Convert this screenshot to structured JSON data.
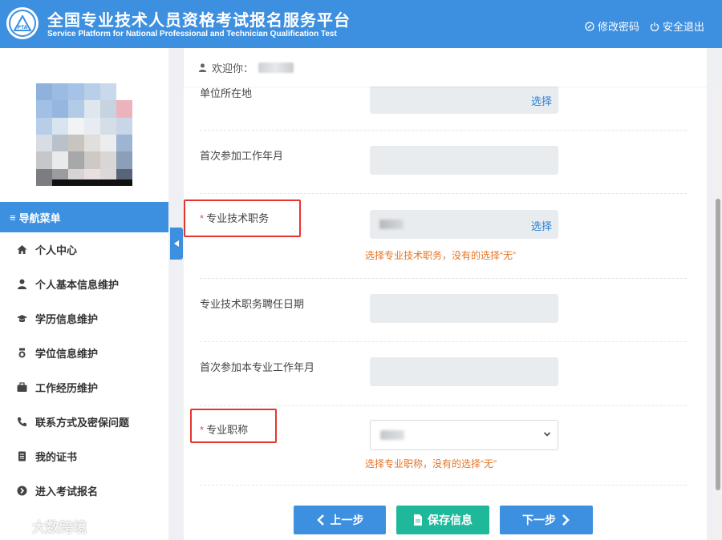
{
  "header": {
    "title_cn": "全国专业技术人员资格考试报名服务平台",
    "title_en": "Service Platform for National Professional and Technician Qualification Test",
    "change_password": "修改密码",
    "logout": "安全退出"
  },
  "sidebar": {
    "nav_title": "导航菜单",
    "items": [
      {
        "label": "个人中心",
        "icon": "home-icon"
      },
      {
        "label": "个人基本信息维护",
        "icon": "user-icon"
      },
      {
        "label": "学历信息维护",
        "icon": "graduation-cap-icon"
      },
      {
        "label": "学位信息维护",
        "icon": "medal-icon"
      },
      {
        "label": "工作经历维护",
        "icon": "briefcase-icon"
      },
      {
        "label": "联系方式及密保问题",
        "icon": "phone-icon"
      },
      {
        "label": "我的证书",
        "icon": "certificate-icon"
      },
      {
        "label": "进入考试报名",
        "icon": "arrow-circle-icon"
      }
    ]
  },
  "welcome": {
    "label": "欢迎你："
  },
  "form": {
    "unit_location": {
      "label": "单位所在地",
      "action": "选择"
    },
    "first_work_date": {
      "label": "首次参加工作年月"
    },
    "tech_position": {
      "required": "*",
      "label": "专业技术职务",
      "action": "选择",
      "hint": "选择专业技术职务，没有的选择“无”"
    },
    "tech_position_date": {
      "label": "专业技术职务聘任日期"
    },
    "first_major_work_date": {
      "label": "首次参加本专业工作年月"
    },
    "title": {
      "required": "*",
      "label": "专业职称",
      "hint": "选择专业职称，没有的选择“无”"
    }
  },
  "buttons": {
    "prev": "上一步",
    "save": "保存信息",
    "next": "下一步"
  },
  "watermark": "大数跨境",
  "colors": {
    "primary": "#3d8fe0",
    "save": "#1fb89a",
    "hint": "#e57425",
    "required": "#d9534f",
    "highlight": "#e5352f"
  }
}
